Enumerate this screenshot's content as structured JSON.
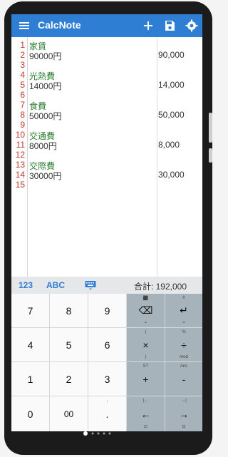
{
  "app": {
    "title": "CalcNote"
  },
  "editor": {
    "line_numbers": [
      "1",
      "2",
      "3",
      "4",
      "5",
      "6",
      "7",
      "8",
      "9",
      "10",
      "11",
      "12",
      "13",
      "14",
      "15"
    ],
    "lines": [
      {
        "n": 1,
        "text": "家賃",
        "kind": "label"
      },
      {
        "n": 2,
        "text": "90000円",
        "kind": "num",
        "result": "90,000"
      },
      {
        "n": 4,
        "text": "光熱費",
        "kind": "label"
      },
      {
        "n": 5,
        "text": "14000円",
        "kind": "num",
        "result": "14,000"
      },
      {
        "n": 7,
        "text": "食費",
        "kind": "label"
      },
      {
        "n": 8,
        "text": "50000円",
        "kind": "num",
        "result": "50,000"
      },
      {
        "n": 10,
        "text": "交通費",
        "kind": "label"
      },
      {
        "n": 11,
        "text": "8000円",
        "kind": "num",
        "result": "8,000"
      },
      {
        "n": 13,
        "text": "交際費",
        "kind": "label"
      },
      {
        "n": 14,
        "text": "30000円",
        "kind": "num",
        "result": "30,000"
      }
    ]
  },
  "keyboard_bar": {
    "mode_123": "123",
    "mode_abc": "ABC",
    "total": "合計: 192,000"
  },
  "keys": {
    "digits": [
      "7",
      "8",
      "9",
      "4",
      "5",
      "6",
      "1",
      "2",
      "3",
      "0",
      "00",
      "."
    ],
    "row1_op2": {
      "main": "↵",
      "top": "#",
      "bottom": "="
    },
    "row1_op1": {
      "main": "⌫",
      "top": "⬛",
      "bottom": "▪"
    },
    "row2_op1": {
      "main": "×",
      "top": "(",
      "bottom": ")"
    },
    "row2_op2": {
      "main": "÷",
      "top": "%",
      "bottom": "mod"
    },
    "row3_op1": {
      "main": "+",
      "top": "ST",
      "bottom": ""
    },
    "row3_op2": {
      "main": "-",
      "top": "Ans",
      "bottom": ""
    },
    "row4_op1": {
      "main": "←",
      "top": "|←",
      "bottom": "⊡"
    },
    "row4_op2": {
      "main": "→",
      "top": "→|",
      "bottom": "⊡"
    },
    "dot_sub": ","
  },
  "colors": {
    "accent": "#2e7ed3",
    "label": "#2e7d32",
    "line_number": "#c0392b"
  },
  "icons": [
    "menu-icon",
    "add-icon",
    "save-icon",
    "settings-icon",
    "keyboard-icon"
  ]
}
